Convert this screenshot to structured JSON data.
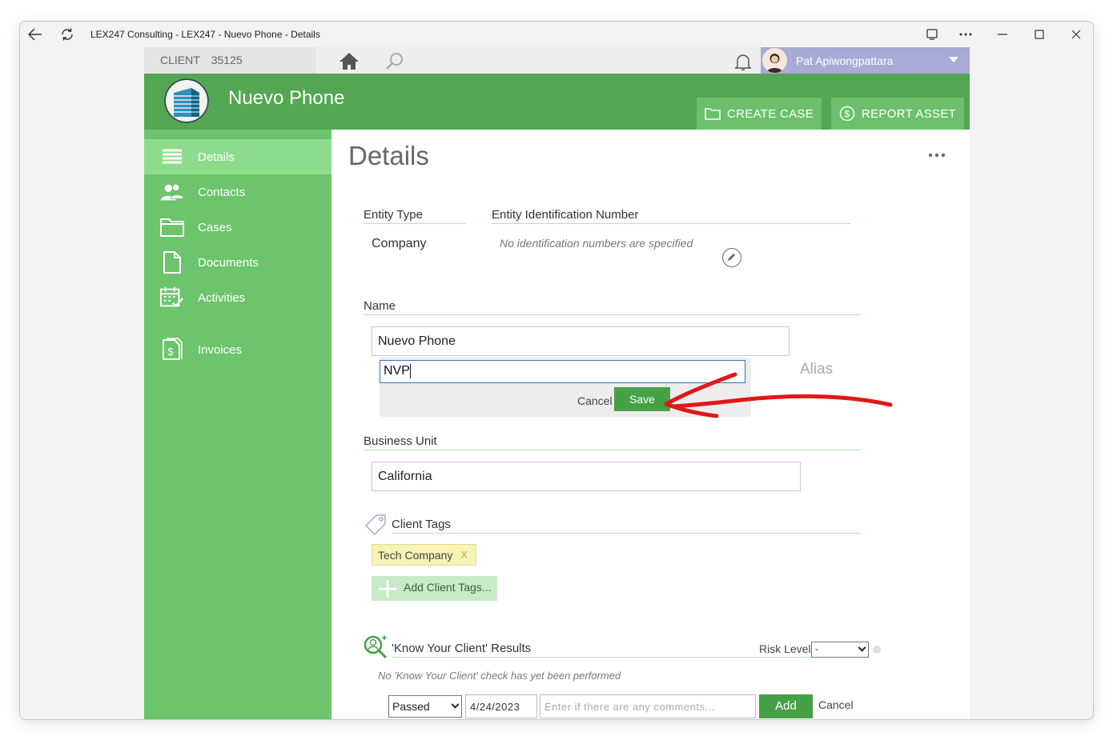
{
  "window": {
    "title": "LEX247 Consulting - LEX247 - Nuevo Phone - Details"
  },
  "topbar": {
    "client_label": "CLIENT",
    "client_number": "35125",
    "user_name": "Pat Apiwongpattara"
  },
  "header": {
    "entity_name": "Nuevo Phone",
    "create_case_label": "CREATE CASE",
    "report_asset_label": "REPORT ASSET"
  },
  "sidebar": {
    "items": [
      {
        "label": "Details",
        "icon": "list-icon",
        "active": true
      },
      {
        "label": "Contacts",
        "icon": "contacts-icon"
      },
      {
        "label": "Cases",
        "icon": "folder-icon"
      },
      {
        "label": "Documents",
        "icon": "document-icon"
      },
      {
        "label": "Activities",
        "icon": "calendar-check-icon"
      },
      {
        "label": "Invoices",
        "icon": "invoice-icon"
      }
    ]
  },
  "main": {
    "page_title": "Details",
    "entity_type_label": "Entity Type",
    "entity_type_value": "Company",
    "entity_id_label": "Entity Identification Number",
    "entity_id_empty": "No identification numbers are specified",
    "name_label": "Name",
    "name_value": "Nuevo Phone",
    "alias_value": "NVP",
    "alias_label": "Alias",
    "cancel_label": "Cancel",
    "save_label": "Save",
    "business_unit_label": "Business Unit",
    "business_unit_value": "California",
    "client_tags_label": "Client Tags",
    "tags": [
      {
        "label": "Tech Company",
        "remove": "X"
      }
    ],
    "add_tags_label": "Add Client Tags...",
    "kyc_label": "'Know Your Client' Results",
    "risk_level_label": "Risk Level:",
    "risk_level_value": "-",
    "kyc_empty": "No 'Know Your Client' check has yet been performed",
    "kyc_status_value": "Passed",
    "kyc_date_value": "4/24/2023",
    "kyc_comments_placeholder": "Enter if there are any comments...",
    "kyc_add_label": "Add",
    "kyc_cancel_label": "Cancel"
  },
  "colors": {
    "header_green": "#53a753",
    "sidebar_green": "#6cc46c",
    "active_nav": "#8ddc8d",
    "button_green": "#46a146",
    "user_bar": "#a7abd6",
    "annotation_red": "#e01818"
  }
}
